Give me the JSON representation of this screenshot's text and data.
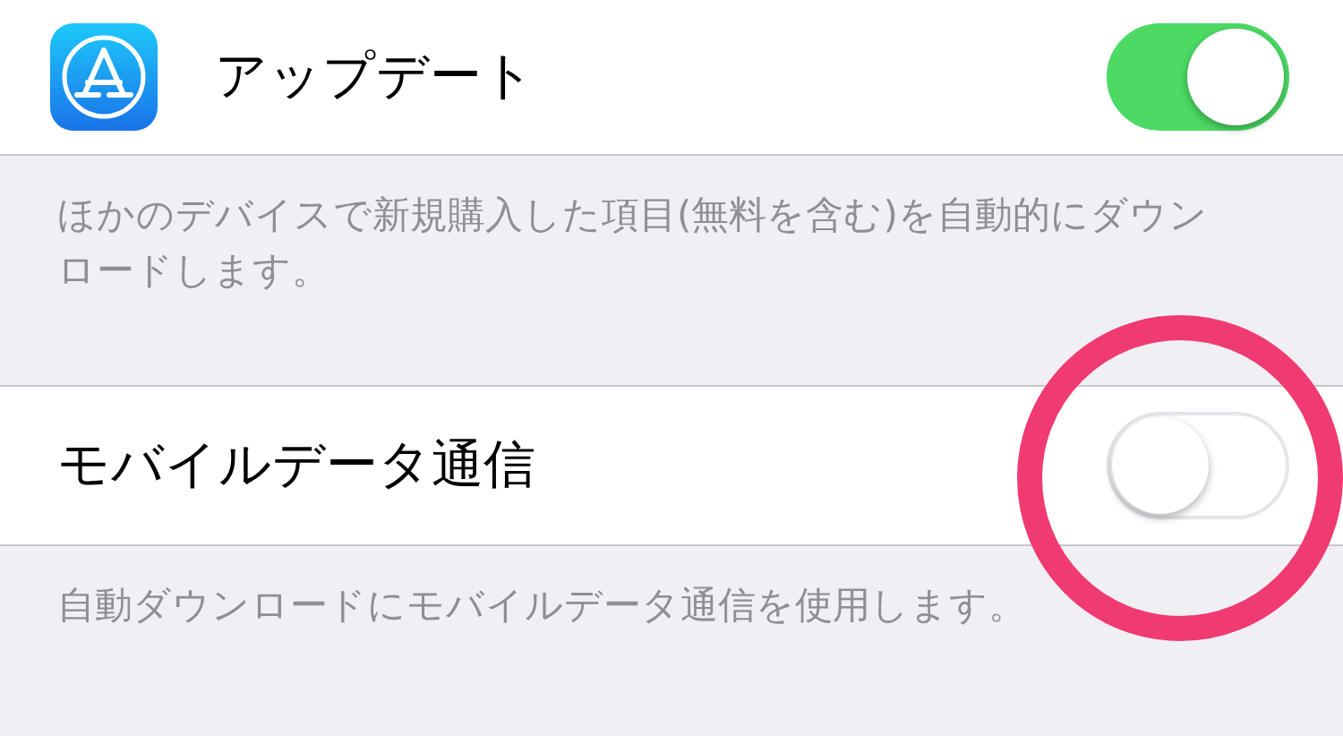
{
  "sections": [
    {
      "has_icon": true,
      "label": "アップデート",
      "on": true,
      "footer": "ほかのデバイスで新規購入した項目(無料を含む)を自動的にダウンロードします。"
    },
    {
      "has_icon": false,
      "label": "モバイルデータ通信",
      "on": false,
      "footer": "自動ダウンロードにモバイルデータ通信を使用します。"
    }
  ],
  "annotation": {
    "kind": "circle"
  }
}
